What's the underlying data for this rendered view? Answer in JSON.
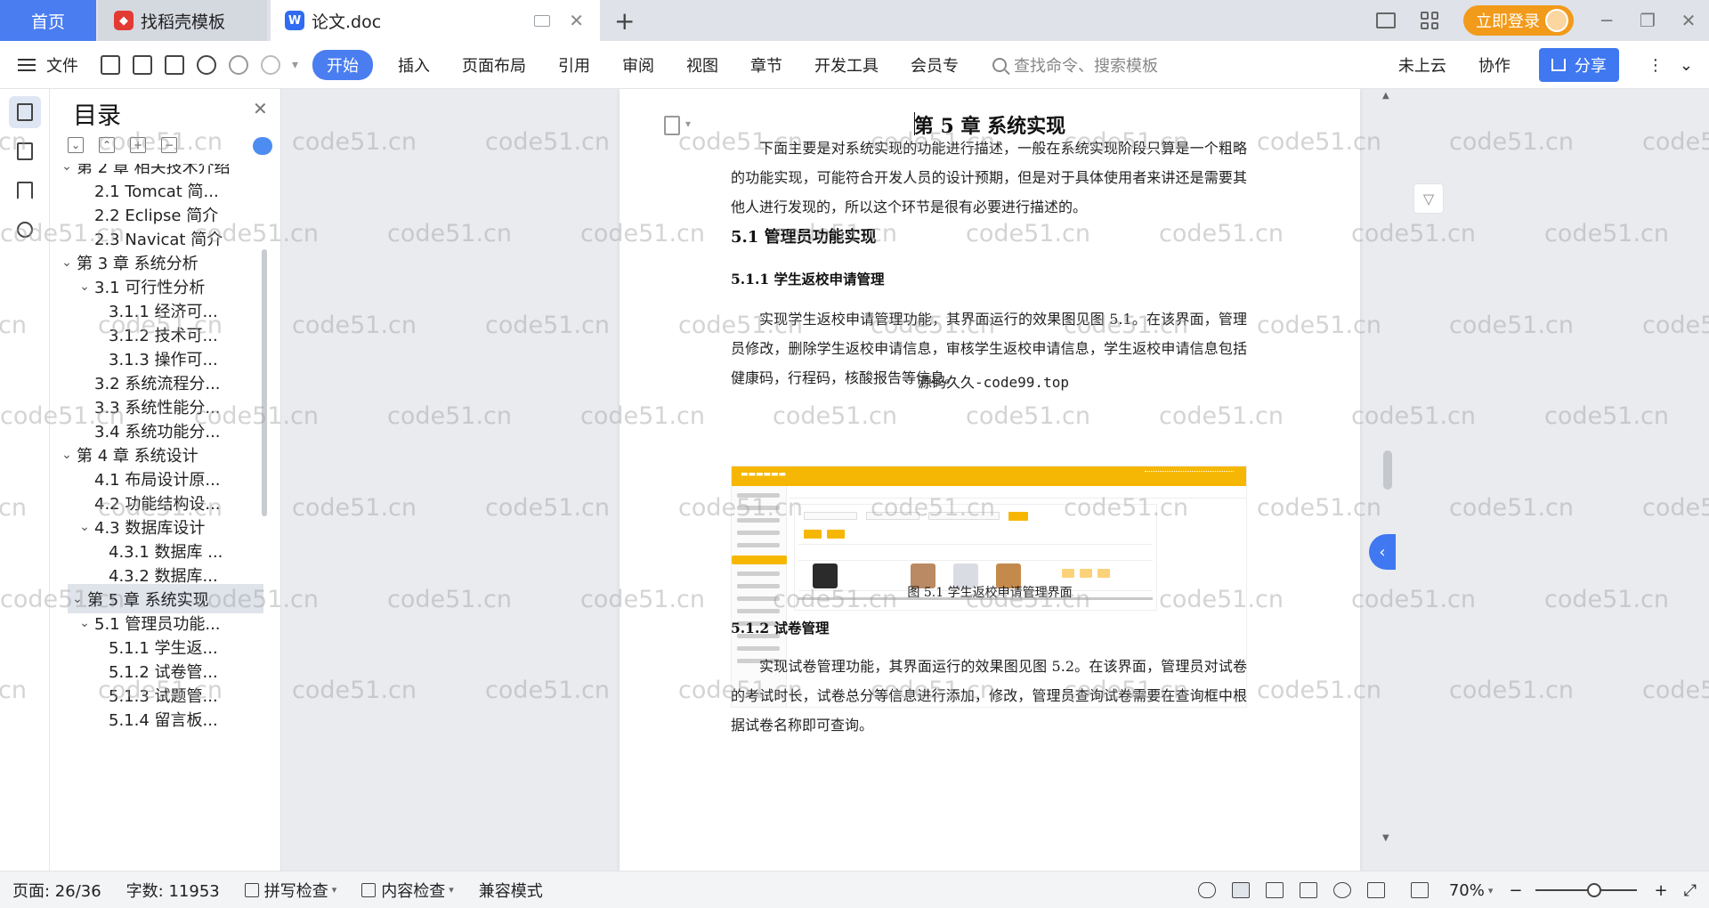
{
  "tabs": {
    "home": "首页",
    "template_tab": "找稻壳模板",
    "doc_tab": "论文.doc",
    "login": "立即登录"
  },
  "ribbon": {
    "file": "文件",
    "tabs": [
      "开始",
      "插入",
      "页面布局",
      "引用",
      "审阅",
      "视图",
      "章节",
      "开发工具",
      "会员专"
    ],
    "search_placeholder": "查找命令、搜索模板",
    "cloud": "未上云",
    "collab": "协作",
    "share": "分享"
  },
  "toc": {
    "title": "目录",
    "items": [
      {
        "label": "第 2 章 相关技术介绍",
        "level": 1,
        "expanded": true
      },
      {
        "label": "2.1 Tomcat 简...",
        "level": 2
      },
      {
        "label": "2.2 Eclipse 简介",
        "level": 2
      },
      {
        "label": "2.3 Navicat 简介",
        "level": 2
      },
      {
        "label": "第 3 章 系统分析",
        "level": 1,
        "expanded": true
      },
      {
        "label": "3.1 可行性分析",
        "level": 2,
        "expanded": true
      },
      {
        "label": "3.1.1 经济可...",
        "level": 3
      },
      {
        "label": "3.1.2 技术可...",
        "level": 3
      },
      {
        "label": "3.1.3 操作可...",
        "level": 3
      },
      {
        "label": "3.2 系统流程分...",
        "level": 2
      },
      {
        "label": "3.3 系统性能分...",
        "level": 2
      },
      {
        "label": "3.4 系统功能分...",
        "level": 2
      },
      {
        "label": "第 4 章 系统设计",
        "level": 1,
        "expanded": true
      },
      {
        "label": "4.1 布局设计原...",
        "level": 2
      },
      {
        "label": "4.2 功能结构设...",
        "level": 2
      },
      {
        "label": "4.3 数据库设计",
        "level": 2,
        "expanded": true
      },
      {
        "label": "4.3.1 数据库 ...",
        "level": 3
      },
      {
        "label": "4.3.2 数据库...",
        "level": 3
      },
      {
        "label": "第 5 章 系统实现",
        "level": 1,
        "expanded": true,
        "selected": true
      },
      {
        "label": "5.1 管理员功能...",
        "level": 2,
        "expanded": true
      },
      {
        "label": "5.1.1 学生返...",
        "level": 3
      },
      {
        "label": "5.1.2 试卷管...",
        "level": 3
      },
      {
        "label": "5.1.3 试题管...",
        "level": 3
      },
      {
        "label": "5.1.4 留言板...",
        "level": 3
      }
    ]
  },
  "document": {
    "chapter_title": "第 5 章 系统实现",
    "intro": "下面主要是对系统实现的功能进行描述，一般在系统实现阶段只算是一个粗略的功能实现，可能符合开发人员的设计预期，但是对于具体使用者来讲还是需要其他人进行发现的，所以这个环节是很有必要进行描述的。",
    "h_5_1": "5.1  管理员功能实现",
    "h_5_1_1": "5.1.1  学生返校申请管理",
    "p_5_1_1": "实现学生返校申请管理功能，其界面运行的效果图见图 5.1。在该界面，管理员修改，删除学生返校申请信息，审核学生返校申请信息，学生返校申请信息包括健康码，行程码，核酸报告等信息。",
    "source_mark": "源码久久-code99.top",
    "figure_caption": "图 5.1  学生返校申请管理界面",
    "h_5_1_2": "5.1.2  试卷管理",
    "p_5_1_2": "实现试卷管理功能，其界面运行的效果图见图 5.2。在该界面，管理员对试卷的考试时长，试卷总分等信息进行添加，修改，管理员查询试卷需要在查询框中根据试卷名称即可查询。"
  },
  "watermark": "code51.cn",
  "status": {
    "page": "页面: 26/36",
    "words": "字数: 11953",
    "spell": "拼写检查",
    "content": "内容检查",
    "compat": "兼容模式",
    "zoom": "70%"
  },
  "colors": {
    "accent": "#4a7df0",
    "login": "#f29a1a",
    "screenshot_header": "#f6b704"
  }
}
